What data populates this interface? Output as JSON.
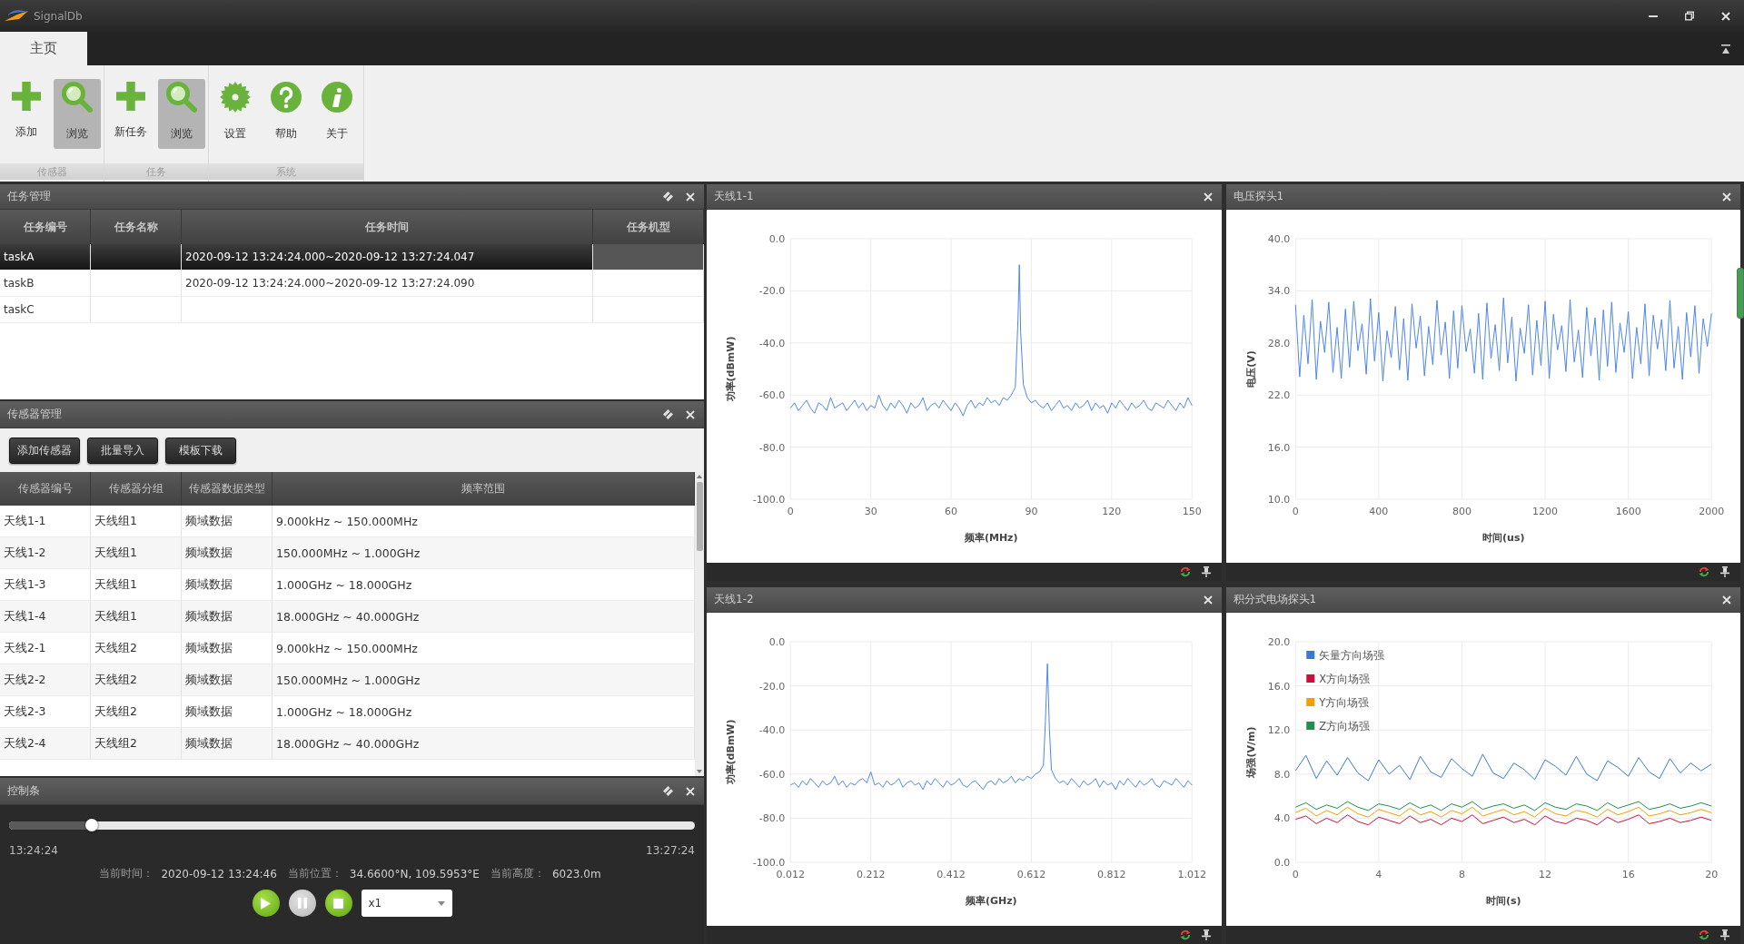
{
  "window": {
    "title": "SignalDb"
  },
  "tabs": [
    {
      "label": "主页",
      "selected": true
    }
  ],
  "ribbon_groups": [
    {
      "label": "传感器",
      "buttons": [
        {
          "label": "添加",
          "kind": "add",
          "selected": false
        },
        {
          "label": "浏览",
          "kind": "browse",
          "selected": true
        }
      ]
    },
    {
      "label": "任务",
      "buttons": [
        {
          "label": "新任务",
          "kind": "add",
          "selected": false
        },
        {
          "label": "浏览",
          "kind": "browse",
          "selected": true
        }
      ]
    },
    {
      "label": "系统",
      "buttons": [
        {
          "label": "设置",
          "kind": "settings",
          "selected": false
        },
        {
          "label": "帮助",
          "kind": "help",
          "selected": false
        },
        {
          "label": "关于",
          "kind": "about",
          "selected": false
        }
      ]
    }
  ],
  "task_panel": {
    "title": "任务管理",
    "columns": [
      "任务编号",
      "任务名称",
      "任务时间",
      "任务机型"
    ],
    "rows": [
      {
        "number": "taskA",
        "time": "2020-09-12 13:24:24.000~2020-09-12 13:27:24.047",
        "selected": true
      },
      {
        "number": "taskB",
        "time": "2020-09-12 13:24:24.000~2020-09-12 13:27:24.090",
        "selected": false
      },
      {
        "number": "taskC",
        "selected": false
      }
    ]
  },
  "sensor_panel": {
    "title": "传感器管理",
    "buttons": [
      "添加传感器",
      "批量导入",
      "模板下载"
    ],
    "columns": [
      "传感器编号",
      "传感器分组",
      "传感器数据类型",
      "频率范围"
    ],
    "rows": [
      {
        "number": "天线1-1",
        "group": "天线组1",
        "data_type": "频域数据",
        "range": "9.000kHz ~ 150.000MHz"
      },
      {
        "number": "天线1-2",
        "group": "天线组1",
        "data_type": "频域数据",
        "range": "150.000MHz ~ 1.000GHz"
      },
      {
        "number": "天线1-3",
        "group": "天线组1",
        "data_type": "频域数据",
        "range": "1.000GHz ~ 18.000GHz"
      },
      {
        "number": "天线1-4",
        "group": "天线组1",
        "data_type": "频域数据",
        "range": "18.000GHz ~ 40.000GHz"
      },
      {
        "number": "天线2-1",
        "group": "天线组2",
        "data_type": "频域数据",
        "range": "9.000kHz ~ 150.000MHz"
      },
      {
        "number": "天线2-2",
        "group": "天线组2",
        "data_type": "频域数据",
        "range": "150.000MHz ~ 1.000GHz"
      },
      {
        "number": "天线2-3",
        "group": "天线组2",
        "data_type": "频域数据",
        "range": "1.000GHz ~ 18.000GHz"
      },
      {
        "number": "天线2-4",
        "group": "天线组2",
        "data_type": "频域数据",
        "range": "18.000GHz ~ 40.000GHz"
      }
    ]
  },
  "control_panel": {
    "title": "控制条",
    "progress": {
      "level": 0.12
    },
    "start_time": "13:24:24",
    "end_time": "13:27:24",
    "status": [
      {
        "label": "当前时间：",
        "value": "2020-09-12 13:24:46"
      },
      {
        "label": "当前位置：",
        "value": "34.6600°N, 109.5953°E"
      },
      {
        "label": "当前高度：",
        "value": "6023.0m"
      }
    ],
    "playback_buttons": [
      {
        "kind": "play",
        "disabled": false
      },
      {
        "kind": "pause",
        "disabled": true
      },
      {
        "kind": "stop",
        "disabled": false
      }
    ],
    "speed": "x1"
  },
  "chart_panels": [
    {
      "title": "天线1-1",
      "chart_data": {
        "type": "line",
        "xlabel": "频率(MHz)",
        "ylabel": "功率(dBmW)",
        "xlim": [
          0,
          150
        ],
        "ylim": [
          -100,
          0
        ],
        "grid": true,
        "xticks": [
          0,
          30,
          60,
          90,
          120,
          150
        ],
        "yticks": [
          {
            "value": 0,
            "label": "0.0"
          },
          {
            "value": -20,
            "label": "-20.0"
          },
          {
            "value": -40,
            "label": "-40.0"
          },
          {
            "value": -60,
            "label": "-60.0"
          },
          {
            "value": -80,
            "label": "-80.0"
          },
          {
            "value": -100,
            "label": "-100.0"
          }
        ],
        "x": [
          0,
          1.5,
          3,
          4.5,
          6,
          7.5,
          9,
          10.5,
          12,
          13.5,
          15,
          16.5,
          18,
          19.5,
          21,
          22.5,
          24,
          25.5,
          27,
          28.5,
          30,
          31.5,
          33,
          34.5,
          36,
          37.5,
          39,
          40.5,
          42,
          43.5,
          45,
          46.5,
          48,
          49.5,
          51,
          52.5,
          54,
          55.5,
          57,
          58.5,
          60,
          61.5,
          63,
          64.5,
          66,
          67.5,
          69,
          70.5,
          72,
          73.5,
          75,
          76.5,
          78,
          79.5,
          81,
          82.5,
          84,
          85,
          85.5,
          86,
          87,
          88.5,
          90,
          91.5,
          93,
          94.5,
          96,
          97.5,
          99,
          100.5,
          102,
          103.5,
          105,
          106.5,
          108,
          109.5,
          111,
          112.5,
          114,
          115.5,
          117,
          118.5,
          120,
          121.5,
          123,
          124.5,
          126,
          127.5,
          129,
          130.5,
          132,
          133.5,
          135,
          136.5,
          138,
          139.5,
          141,
          142.5,
          144,
          145.5,
          147,
          148.5,
          150
        ],
        "series": [
          {
            "color": "#4f86ec",
            "values": [
              -65,
              -63,
              -66,
              -64,
              -62,
              -65,
              -67,
              -63,
              -64,
              -66,
              -61,
              -65,
              -64,
              -63,
              -66,
              -64,
              -62,
              -65,
              -63,
              -66,
              -64,
              -65,
              -60,
              -64,
              -66,
              -63,
              -65,
              -62,
              -64,
              -67,
              -63,
              -65,
              -64,
              -61,
              -66,
              -64,
              -63,
              -65,
              -62,
              -64,
              -66,
              -63,
              -65,
              -68,
              -64,
              -62,
              -65,
              -63,
              -64,
              -61,
              -63,
              -62,
              -64,
              -61,
              -62,
              -60,
              -57,
              -31,
              -10,
              -36,
              -56,
              -61,
              -63,
              -62,
              -64,
              -65,
              -63,
              -66,
              -64,
              -62,
              -65,
              -64,
              -66,
              -63,
              -65,
              -64,
              -62,
              -66,
              -63,
              -65,
              -64,
              -67,
              -63,
              -65,
              -62,
              -64,
              -66,
              -63,
              -65,
              -64,
              -62,
              -65,
              -66,
              -63,
              -64,
              -65,
              -62,
              -64,
              -66,
              -63,
              -65,
              -61,
              -64
            ]
          }
        ]
      }
    },
    {
      "title": "电压探头1",
      "chart_data": {
        "type": "line",
        "xlabel": "时间(us)",
        "ylabel": "电压(V)",
        "xlim": [
          0,
          2000
        ],
        "ylim": [
          10,
          40
        ],
        "grid": true,
        "xticks": [
          0,
          400,
          800,
          1200,
          1600,
          2000
        ],
        "yticks": [
          {
            "value": 10,
            "label": "10.0"
          },
          {
            "value": 16,
            "label": "16.0"
          },
          {
            "value": 22,
            "label": "22.0"
          },
          {
            "value": 28,
            "label": "28.0"
          },
          {
            "value": 34,
            "label": "34.0"
          },
          {
            "value": 40,
            "label": "40.0"
          }
        ],
        "x": [
          0,
          20,
          40,
          60,
          80,
          100,
          120,
          140,
          160,
          180,
          200,
          220,
          240,
          260,
          280,
          300,
          320,
          340,
          360,
          380,
          400,
          420,
          440,
          460,
          480,
          500,
          520,
          540,
          560,
          580,
          600,
          620,
          640,
          660,
          680,
          700,
          720,
          740,
          760,
          780,
          800,
          820,
          840,
          860,
          880,
          900,
          920,
          940,
          960,
          980,
          1000,
          1020,
          1040,
          1060,
          1080,
          1100,
          1120,
          1140,
          1160,
          1180,
          1200,
          1220,
          1240,
          1260,
          1280,
          1300,
          1320,
          1340,
          1360,
          1380,
          1400,
          1420,
          1440,
          1460,
          1480,
          1500,
          1520,
          1540,
          1560,
          1580,
          1600,
          1620,
          1640,
          1660,
          1680,
          1700,
          1720,
          1740,
          1760,
          1780,
          1800,
          1820,
          1840,
          1860,
          1880,
          1900,
          1920,
          1940,
          1960,
          1980,
          2000
        ],
        "series": [
          {
            "color": "#4f86ec",
            "values": [
              32.4,
              24.1,
              31.2,
              25.6,
              33.0,
              23.8,
              30.5,
              26.9,
              32.7,
              24.6,
              29.8,
              23.9,
              31.9,
              25.2,
              32.8,
              27.1,
              30.2,
              24.4,
              33.1,
              25.9,
              31.5,
              23.6,
              29.4,
              26.3,
              32.2,
              24.9,
              30.8,
              23.7,
              32.5,
              27.4,
              31.1,
              24.2,
              29.9,
              25.5,
              32.9,
              26.6,
              30.4,
              23.9,
              31.7,
              25.1,
              32.3,
              27.0,
              29.6,
              24.5,
              31.4,
              23.8,
              32.6,
              26.2,
              30.1,
              24.8,
              33.2,
              25.7,
              31.0,
              23.6,
              29.7,
              26.8,
              32.4,
              24.3,
              30.6,
              25.4,
              32.8,
              23.9,
              31.3,
              27.2,
              30.0,
              24.7,
              33.0,
              25.8,
              29.5,
              24.0,
              32.1,
              26.5,
              30.9,
              23.7,
              31.8,
              25.3,
              32.7,
              24.6,
              30.3,
              26.9,
              31.6,
              23.9,
              29.8,
              25.6,
              32.5,
              24.2,
              31.2,
              27.3,
              30.7,
              24.8,
              32.9,
              25.1,
              29.9,
              23.8,
              31.5,
              26.4,
              32.3,
              24.5,
              30.8,
              27.6,
              31.4
            ]
          }
        ]
      }
    },
    {
      "title": "天线1-2",
      "chart_data": {
        "type": "line",
        "xlabel": "频率(GHz)",
        "ylabel": "功率(dBmW)",
        "xlim": [
          0.012,
          1.012
        ],
        "ylim": [
          -100,
          0
        ],
        "grid": true,
        "xticks": [
          0.012,
          0.212,
          0.412,
          0.612,
          0.812,
          1.012
        ],
        "yticks": [
          {
            "value": 0,
            "label": "0.0"
          },
          {
            "value": -20,
            "label": "-20.0"
          },
          {
            "value": -40,
            "label": "-40.0"
          },
          {
            "value": -60,
            "label": "-60.0"
          },
          {
            "value": -80,
            "label": "-80.0"
          },
          {
            "value": -100,
            "label": "-100.0"
          }
        ],
        "x": [
          0.012,
          0.022,
          0.032,
          0.042,
          0.052,
          0.062,
          0.072,
          0.082,
          0.092,
          0.102,
          0.112,
          0.122,
          0.132,
          0.142,
          0.152,
          0.162,
          0.172,
          0.182,
          0.192,
          0.202,
          0.212,
          0.222,
          0.232,
          0.242,
          0.252,
          0.262,
          0.272,
          0.282,
          0.292,
          0.302,
          0.312,
          0.322,
          0.332,
          0.342,
          0.352,
          0.362,
          0.372,
          0.382,
          0.392,
          0.402,
          0.412,
          0.422,
          0.432,
          0.442,
          0.452,
          0.462,
          0.472,
          0.482,
          0.492,
          0.502,
          0.512,
          0.522,
          0.532,
          0.542,
          0.552,
          0.562,
          0.572,
          0.582,
          0.592,
          0.602,
          0.612,
          0.622,
          0.632,
          0.642,
          0.647,
          0.652,
          0.657,
          0.662,
          0.672,
          0.682,
          0.692,
          0.702,
          0.712,
          0.722,
          0.732,
          0.742,
          0.752,
          0.762,
          0.772,
          0.782,
          0.792,
          0.802,
          0.812,
          0.822,
          0.832,
          0.842,
          0.852,
          0.862,
          0.872,
          0.882,
          0.892,
          0.902,
          0.912,
          0.922,
          0.932,
          0.942,
          0.952,
          0.962,
          0.972,
          0.982,
          0.992,
          1.002,
          1.012
        ],
        "series": [
          {
            "color": "#4f86ec",
            "values": [
              -65,
              -64,
              -66,
              -63,
              -65,
              -62,
              -64,
              -66,
              -63,
              -65,
              -64,
              -61,
              -65,
              -63,
              -66,
              -64,
              -65,
              -63,
              -62,
              -64,
              -59,
              -65,
              -64,
              -66,
              -63,
              -65,
              -64,
              -62,
              -66,
              -64,
              -63,
              -65,
              -64,
              -67,
              -63,
              -65,
              -62,
              -64,
              -66,
              -63,
              -65,
              -64,
              -62,
              -65,
              -66,
              -64,
              -63,
              -65,
              -67,
              -64,
              -63,
              -65,
              -62,
              -64,
              -63,
              -61,
              -64,
              -62,
              -63,
              -61,
              -62,
              -60,
              -59,
              -56,
              -36,
              -10,
              -40,
              -58,
              -62,
              -64,
              -63,
              -65,
              -62,
              -64,
              -66,
              -63,
              -65,
              -64,
              -62,
              -66,
              -63,
              -65,
              -64,
              -67,
              -63,
              -65,
              -62,
              -64,
              -66,
              -63,
              -65,
              -64,
              -62,
              -65,
              -66,
              -63,
              -64,
              -65,
              -62,
              -64,
              -66,
              -63,
              -65
            ]
          }
        ]
      }
    },
    {
      "title": "积分式电场探头1",
      "chart_data": {
        "type": "line",
        "xlabel": "时间(s)",
        "ylabel": "场强(V/m)",
        "xlim": [
          0,
          20
        ],
        "ylim": [
          0,
          20
        ],
        "grid": true,
        "legend": "upper left",
        "xticks": [
          0,
          4,
          8,
          12,
          16,
          20
        ],
        "yticks": [
          {
            "value": 0,
            "label": "0.0"
          },
          {
            "value": 4,
            "label": "4.0"
          },
          {
            "value": 8,
            "label": "8.0"
          },
          {
            "value": 12,
            "label": "12.0"
          },
          {
            "value": 16,
            "label": "16.0"
          },
          {
            "value": 20,
            "label": "20.0"
          }
        ],
        "x": [
          0,
          0.5,
          1,
          1.5,
          2,
          2.5,
          3,
          3.5,
          4,
          4.5,
          5,
          5.5,
          6,
          6.5,
          7,
          7.5,
          8,
          8.5,
          9,
          9.5,
          10,
          10.5,
          11,
          11.5,
          12,
          12.5,
          13,
          13.5,
          14,
          14.5,
          15,
          15.5,
          16,
          16.5,
          17,
          17.5,
          18,
          18.5,
          19,
          19.5,
          20
        ],
        "series": [
          {
            "name": "矢量方向场强",
            "color": "#3a78d8",
            "values": [
              8.3,
              9.7,
              7.6,
              9.2,
              7.9,
              9.5,
              8.1,
              7.4,
              9.3,
              8.0,
              8.8,
              7.5,
              9.6,
              8.2,
              7.7,
              9.4,
              8.5,
              7.8,
              9.8,
              8.1,
              7.6,
              9.0,
              8.4,
              7.5,
              9.3,
              8.7,
              7.9,
              9.6,
              8.0,
              7.4,
              9.2,
              8.6,
              7.8,
              9.5,
              8.2,
              7.6,
              9.4,
              8.1,
              9.0,
              8.3,
              8.9
            ]
          },
          {
            "name": "X方向场强",
            "color": "#d0103a",
            "values": [
              3.9,
              4.2,
              3.5,
              4.0,
              3.6,
              4.3,
              3.7,
              3.4,
              4.1,
              3.8,
              3.5,
              4.2,
              3.6,
              3.9,
              3.4,
              4.0,
              3.7,
              4.3,
              3.5,
              3.8,
              4.1,
              3.6,
              3.9,
              3.4,
              4.2,
              3.7,
              3.5,
              4.0,
              3.8,
              3.4,
              4.1,
              3.6,
              3.9,
              4.3,
              3.5,
              3.7,
              4.0,
              3.6,
              3.8,
              4.1,
              3.8
            ]
          },
          {
            "name": "Y方向场强",
            "color": "#f0a000",
            "values": [
              4.5,
              4.9,
              4.2,
              4.7,
              4.3,
              5.0,
              4.4,
              4.1,
              4.8,
              4.5,
              4.2,
              4.9,
              4.3,
              4.6,
              4.1,
              4.7,
              4.4,
              5.0,
              4.2,
              4.5,
              4.8,
              4.3,
              4.6,
              4.1,
              4.9,
              4.4,
              4.2,
              4.7,
              4.5,
              4.1,
              4.8,
              4.3,
              4.6,
              5.0,
              4.2,
              4.4,
              4.7,
              4.3,
              4.5,
              4.8,
              4.5
            ]
          },
          {
            "name": "Z方向场强",
            "color": "#1e9050",
            "values": [
              5.0,
              5.4,
              4.8,
              5.2,
              4.9,
              5.5,
              5.0,
              4.7,
              5.3,
              5.1,
              4.8,
              5.4,
              4.9,
              5.2,
              4.7,
              5.3,
              5.0,
              5.5,
              4.8,
              5.1,
              5.3,
              4.9,
              5.2,
              4.7,
              5.4,
              5.0,
              4.8,
              5.3,
              5.1,
              4.7,
              5.4,
              4.9,
              5.2,
              5.5,
              4.8,
              5.0,
              5.3,
              4.9,
              5.1,
              5.4,
              5.1
            ]
          }
        ]
      }
    }
  ]
}
